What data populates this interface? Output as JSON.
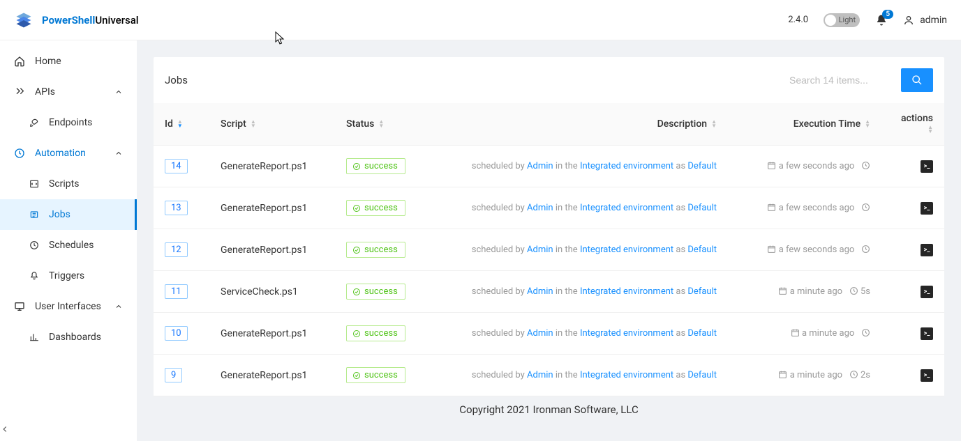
{
  "header": {
    "brand_ps": "PowerShell",
    "brand_uni": "Universal",
    "version": "2.4.0",
    "theme_label": "Light",
    "notif_count": "5",
    "username": "admin"
  },
  "sidebar": {
    "home": "Home",
    "apis": "APIs",
    "endpoints": "Endpoints",
    "automation": "Automation",
    "scripts": "Scripts",
    "jobs": "Jobs",
    "schedules": "Schedules",
    "triggers": "Triggers",
    "user_interfaces": "User Interfaces",
    "dashboards": "Dashboards"
  },
  "page": {
    "title": "Jobs",
    "search_placeholder": "Search 14 items..."
  },
  "columns": {
    "id": "Id",
    "script": "Script",
    "status": "Status",
    "description": "Description",
    "exec": "Execution Time",
    "actions": "actions"
  },
  "rows": [
    {
      "id": "14",
      "script": "GenerateReport.ps1",
      "status": "success",
      "scheduled_by": "scheduled by",
      "user": "Admin",
      "in_the": "in the",
      "env": "Integrated environment",
      "as": "as",
      "def": "Default",
      "time": "a few seconds ago",
      "dur": ""
    },
    {
      "id": "13",
      "script": "GenerateReport.ps1",
      "status": "success",
      "scheduled_by": "scheduled by",
      "user": "Admin",
      "in_the": "in the",
      "env": "Integrated environment",
      "as": "as",
      "def": "Default",
      "time": "a few seconds ago",
      "dur": ""
    },
    {
      "id": "12",
      "script": "GenerateReport.ps1",
      "status": "success",
      "scheduled_by": "scheduled by",
      "user": "Admin",
      "in_the": "in the",
      "env": "Integrated environment",
      "as": "as",
      "def": "Default",
      "time": "a few seconds ago",
      "dur": ""
    },
    {
      "id": "11",
      "script": "ServiceCheck.ps1",
      "status": "success",
      "scheduled_by": "scheduled by",
      "user": "Admin",
      "in_the": "in the",
      "env": "Integrated environment",
      "as": "as",
      "def": "Default",
      "time": "a minute ago",
      "dur": "5s"
    },
    {
      "id": "10",
      "script": "GenerateReport.ps1",
      "status": "success",
      "scheduled_by": "scheduled by",
      "user": "Admin",
      "in_the": "in the",
      "env": "Integrated environment",
      "as": "as",
      "def": "Default",
      "time": "a minute ago",
      "dur": ""
    },
    {
      "id": "9",
      "script": "GenerateReport.ps1",
      "status": "success",
      "scheduled_by": "scheduled by",
      "user": "Admin",
      "in_the": "in the",
      "env": "Integrated environment",
      "as": "as",
      "def": "Default",
      "time": "a minute ago",
      "dur": "2s"
    }
  ],
  "footer": "Copyright 2021 Ironman Software, LLC"
}
